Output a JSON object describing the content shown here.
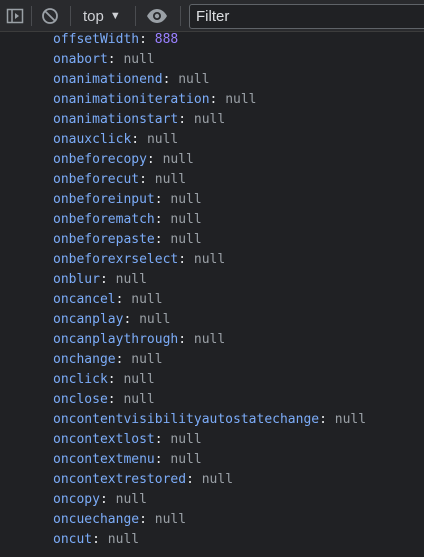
{
  "toolbar": {
    "context_label": "top",
    "context_arrow": "▼",
    "filter_placeholder": "Filter",
    "icons": [
      "sidebar-toggle-icon",
      "clear-console-icon",
      "eye-icon"
    ]
  },
  "properties": [
    {
      "key": "offsetWidth",
      "value": "888",
      "type": "number"
    },
    {
      "key": "onabort",
      "value": "null",
      "type": "null"
    },
    {
      "key": "onanimationend",
      "value": "null",
      "type": "null"
    },
    {
      "key": "onanimationiteration",
      "value": "null",
      "type": "null"
    },
    {
      "key": "onanimationstart",
      "value": "null",
      "type": "null"
    },
    {
      "key": "onauxclick",
      "value": "null",
      "type": "null"
    },
    {
      "key": "onbeforecopy",
      "value": "null",
      "type": "null"
    },
    {
      "key": "onbeforecut",
      "value": "null",
      "type": "null"
    },
    {
      "key": "onbeforeinput",
      "value": "null",
      "type": "null"
    },
    {
      "key": "onbeforematch",
      "value": "null",
      "type": "null"
    },
    {
      "key": "onbeforepaste",
      "value": "null",
      "type": "null"
    },
    {
      "key": "onbeforexrselect",
      "value": "null",
      "type": "null"
    },
    {
      "key": "onblur",
      "value": "null",
      "type": "null"
    },
    {
      "key": "oncancel",
      "value": "null",
      "type": "null"
    },
    {
      "key": "oncanplay",
      "value": "null",
      "type": "null"
    },
    {
      "key": "oncanplaythrough",
      "value": "null",
      "type": "null"
    },
    {
      "key": "onchange",
      "value": "null",
      "type": "null"
    },
    {
      "key": "onclick",
      "value": "null",
      "type": "null"
    },
    {
      "key": "onclose",
      "value": "null",
      "type": "null"
    },
    {
      "key": "oncontentvisibilityautostatechange",
      "value": "null",
      "type": "null"
    },
    {
      "key": "oncontextlost",
      "value": "null",
      "type": "null"
    },
    {
      "key": "oncontextmenu",
      "value": "null",
      "type": "null"
    },
    {
      "key": "oncontextrestored",
      "value": "null",
      "type": "null"
    },
    {
      "key": "oncopy",
      "value": "null",
      "type": "null"
    },
    {
      "key": "oncuechange",
      "value": "null",
      "type": "null"
    },
    {
      "key": "oncut",
      "value": "null",
      "type": "null"
    }
  ],
  "colors": {
    "key": "#7cacf8",
    "null_value": "#9aa0a6",
    "number_value": "#9980ff",
    "background": "#202124"
  }
}
